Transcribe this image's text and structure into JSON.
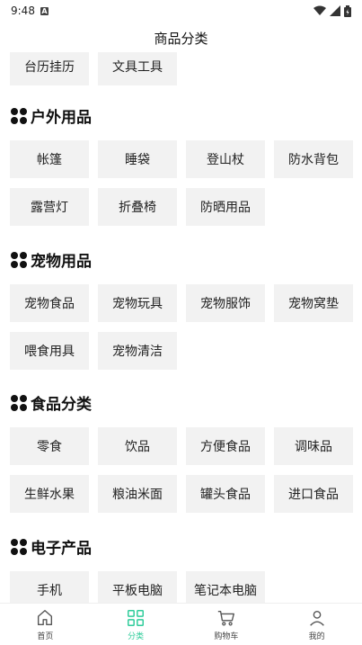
{
  "status_bar": {
    "time": "9:48",
    "badge": "A"
  },
  "header": {
    "title": "商品分类"
  },
  "top_items": [
    "台历挂历",
    "文具工具"
  ],
  "sections": [
    {
      "title": "户外用品",
      "items": [
        "帐篷",
        "睡袋",
        "登山杖",
        "防水背包",
        "露营灯",
        "折叠椅",
        "防晒用品"
      ]
    },
    {
      "title": "宠物用品",
      "items": [
        "宠物食品",
        "宠物玩具",
        "宠物服饰",
        "宠物窝垫",
        "喂食用具",
        "宠物清洁"
      ]
    },
    {
      "title": "食品分类",
      "items": [
        "零食",
        "饮品",
        "方便食品",
        "调味品",
        "生鲜水果",
        "粮油米面",
        "罐头食品",
        "进口食品"
      ]
    },
    {
      "title": "电子产品",
      "items": [
        "手机",
        "平板电脑",
        "笔记本电脑"
      ]
    }
  ],
  "tabbar": {
    "items": [
      {
        "label": "首页",
        "icon": "home-icon"
      },
      {
        "label": "分类",
        "icon": "grid-icon"
      },
      {
        "label": "购物车",
        "icon": "cart-icon"
      },
      {
        "label": "我的",
        "icon": "user-icon"
      }
    ],
    "active_color": "#2ecc9a"
  }
}
